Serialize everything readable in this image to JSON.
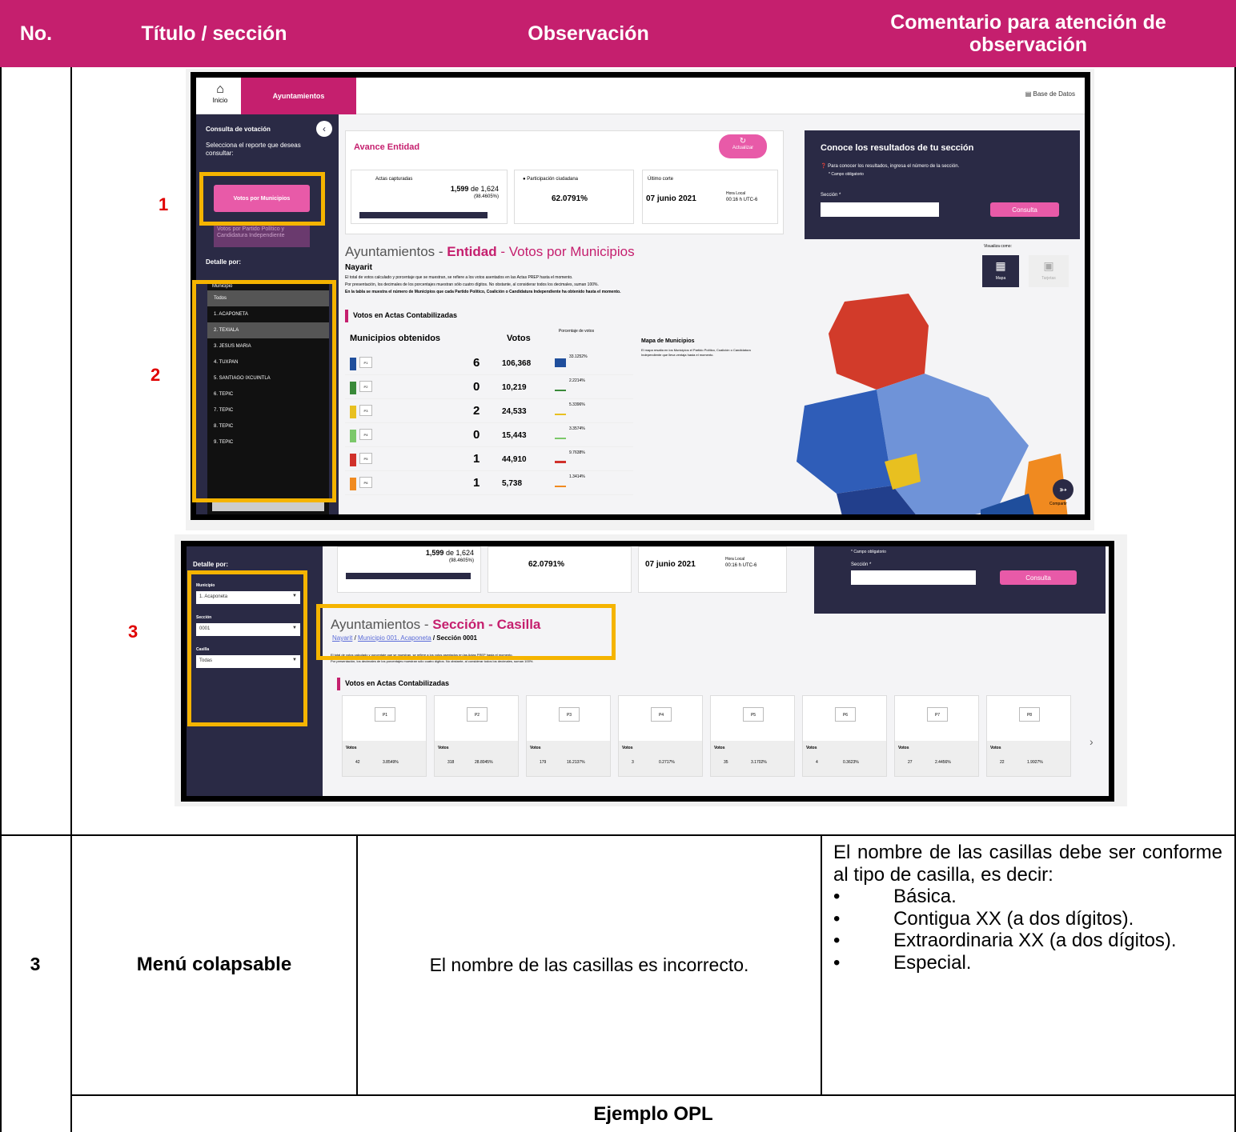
{
  "header": {
    "col_no": "No.",
    "col_title": "Título / sección",
    "col_obs": "Observación",
    "col_comment": "Comentario para atención de observación"
  },
  "row1": {
    "no": "3"
  },
  "markers": {
    "m1": "1",
    "m2": "2",
    "m3": "3"
  },
  "shot1": {
    "home_label": "Inicio",
    "tab": "Ayuntamientos",
    "db_link": "Base de Datos",
    "sidebar_title": "Consulta de votación",
    "sidebar_desc": "Selecciona el reporte que deseas consultar:",
    "btn_votos_municipio": "Votos por Municipios",
    "btn_votos_partido": "Votos por Partido Político y Candidatura Independiente",
    "detalle": "Detalle por:",
    "municipio_label": "Municipio",
    "list": [
      "Todos",
      "1. ACAPONETA",
      "2. TEXIALA",
      "3. JESUS MARIA",
      "4. TUXPAN",
      "5. SANTIAGO IXCUINTLA",
      "6. TEPIC",
      "7. TEPIC",
      "8. TEPIC",
      "9. TEPIC"
    ],
    "avance_title": "Avance Entidad",
    "actualizar": "Actualizar",
    "actas_label": "Actas capturadas",
    "actas_value": "1,599",
    "actas_de": "de 1,624",
    "actas_pct": "(98.4605%)",
    "part_label": "Participación ciudadana",
    "part_value": "62.0791%",
    "corte_label": "Último corte",
    "corte_date": "07 junio 2021",
    "hora_local": "Hora Local",
    "corte_time": "00:16 h UTC-6",
    "conoce_title": "Conoce los resultados de tu sección",
    "conoce_desc": "Para conocer los resultados, ingresa el número de la sección.",
    "campo_oblig": "* Campo obligatorio",
    "seccion_label": "Sección *",
    "consulta_btn": "Consulta",
    "page_title_a": "Ayuntamientos - ",
    "page_title_b": "Entidad",
    "page_title_c": " - Votos por Municipios",
    "state": "Nayarit",
    "desc1": "El total de votos calculado y porcentaje que se muestran, se refiere a los votos asentados en las Actas PREP hasta el momento.",
    "desc2": "Por presentación, los decimales de los porcentajes muestran sólo cuatro dígitos. No obstante, al considerar todos los decimales, suman 100%.",
    "desc3": "En la tabla se muestra el número de Municipios que cada Partido Político, Coalición o Candidatura Independiente ha obtenido hasta el momento.",
    "visualiza": "Visualiza como:",
    "mapa_btn": "Mapa",
    "tabla_btn": "Tarjetas",
    "votos_actas": "Votos en Actas Contabilizadas",
    "col_mun": "Municipios obtenidos",
    "col_votos": "Votos",
    "col_pct": "Porcentaje de votos",
    "mapa_title": "Mapa de Municipios",
    "mapa_desc": "El mapa resalta en los Municipios el Partido Político, Coalición o Candidatura Independiente que lleva ventaja hasta el momento.",
    "compartir": "Compartir",
    "rows": [
      {
        "party": "P1",
        "mun": "6",
        "votos": "106,368",
        "pct": "33.1252%",
        "color": "#1f4e9c"
      },
      {
        "party": "P2",
        "mun": "0",
        "votos": "10,219",
        "pct": "2.2214%",
        "color": "#3a8a3a"
      },
      {
        "party": "P3",
        "mun": "2",
        "votos": "24,533",
        "pct": "5.3396%",
        "color": "#e8c020"
      },
      {
        "party": "P4",
        "mun": "0",
        "votos": "15,443",
        "pct": "3.3574%",
        "color": "#7cc86a"
      },
      {
        "party": "P5",
        "mun": "1",
        "votos": "44,910",
        "pct": "9.7638%",
        "color": "#d0302a"
      },
      {
        "party": "P6",
        "mun": "1",
        "votos": "5,738",
        "pct": "1.3414%",
        "color": "#f08a20"
      }
    ]
  },
  "shot2": {
    "detalle": "Detalle por:",
    "municipio_label": "Municipio",
    "municipio_value": "1. Acaponeta",
    "seccion_label": "Sección",
    "seccion_value": "0001",
    "casilla_label": "Casilla",
    "casilla_value": "Todas",
    "actas_value": "1,599",
    "actas_de": "de 1,624",
    "actas_pct": "(98.4605%)",
    "part_value": "62.0791%",
    "corte_date": "07 junio 2021",
    "hora_local": "Hora Local",
    "corte_time": "00:16 h UTC-6",
    "campo_oblig": "* Campo obligatorio",
    "seccion_field": "Sección *",
    "consulta_btn": "Consulta",
    "title_a": "Ayuntamientos - ",
    "title_b": "Sección - Casilla",
    "crumb_a": "Nayarit",
    "crumb_sep": " / ",
    "crumb_b": "Municipio 001. Acaponeta",
    "crumb_c": " / Sección 0001",
    "desc1": "El total de votos calculado y porcentaje que se muestran, se refiere a los votos asentados en las Actas PREP hasta el momento.",
    "desc2": "Por presentación, los decimales de los porcentajes muestran sólo cuatro dígitos. No obstante, al considerar todos los decimales, suman 100%.",
    "votos_actas": "Votos en Actas Contabilizadas",
    "cards": [
      {
        "p": "P1",
        "label": "Votos",
        "v": "42",
        "pct": "3.8549%"
      },
      {
        "p": "P2",
        "label": "Votos",
        "v": "318",
        "pct": "28.8045%"
      },
      {
        "p": "P3",
        "label": "Votos",
        "v": "179",
        "pct": "16.2137%"
      },
      {
        "p": "P4",
        "label": "Votos",
        "v": "3",
        "pct": "0.2717%"
      },
      {
        "p": "P5",
        "label": "Votos",
        "v": "35",
        "pct": "3.1702%"
      },
      {
        "p": "P6",
        "label": "Votos",
        "v": "4",
        "pct": "0.3623%"
      },
      {
        "p": "P7",
        "label": "Votos",
        "v": "27",
        "pct": "2.4456%"
      },
      {
        "p": "P8",
        "label": "Votos",
        "v": "22",
        "pct": "1.9927%"
      }
    ]
  },
  "row2": {
    "no": "3",
    "title": "Menú colapsable",
    "obs": "El nombre de las casillas es incorrecto.",
    "comment_intro": "El nombre de las casillas debe ser conforme al tipo de casilla, es decir:",
    "bullets": [
      "Básica.",
      "Contigua XX (a dos dígitos).",
      "Extraordinaria XX (a dos dígitos).",
      "Especial."
    ]
  },
  "footer": {
    "ejemplo": "Ejemplo OPL"
  }
}
